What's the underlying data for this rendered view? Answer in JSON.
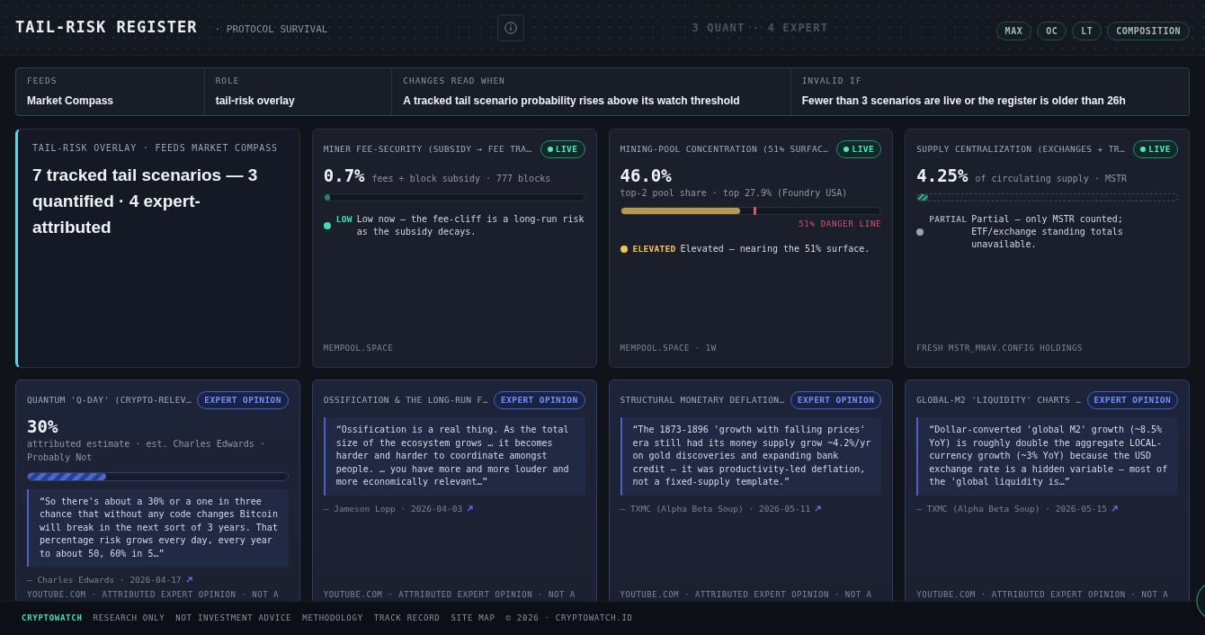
{
  "header": {
    "title": "TAIL-RISK REGISTER",
    "subtitle": "· PROTOCOL SURVIVAL",
    "summary": "3 QUANT · 4 EXPERT",
    "nav": [
      "MAX",
      "OC",
      "LT",
      "COMPOSITION"
    ]
  },
  "info_strip": [
    {
      "label": "FEEDS",
      "value": "Market Compass"
    },
    {
      "label": "ROLE",
      "value": "tail-risk overlay"
    },
    {
      "label": "CHANGES READ WHEN",
      "value": "A tracked tail scenario probability rises above its watch threshold"
    },
    {
      "label": "INVALID IF",
      "value": "Fewer than 3 scenarios are live or the register is older than 26h"
    }
  ],
  "overview": {
    "eyebrow": "TAIL-RISK OVERLAY · FEEDS MARKET COMPASS",
    "headline": "7 tracked tail scenarios — 3 quantified · 4 expert-attributed"
  },
  "scenarios": [
    {
      "kind": "quant",
      "title": "MINER FEE-SECURITY (SUBSIDY → FEE TRA…",
      "badge": {
        "kind": "live",
        "label": "LIVE"
      },
      "value": "0.7%",
      "caption": "fees ÷ block subsidy · 777 blocks",
      "meter": {
        "kind": "solid",
        "level": 0.02
      },
      "status": {
        "label": "LOW",
        "color": "#3ee0b0",
        "text": "Low now — the fee-cliff is a long-run risk as the subsidy decays."
      },
      "source": "MEMPOOL.SPACE"
    },
    {
      "kind": "quant",
      "title": "MINING-POOL CONCENTRATION (51% SURFAC…",
      "badge": {
        "kind": "live",
        "label": "LIVE"
      },
      "value": "46.0%",
      "caption": "top-2 pool share · top 27.9% (Foundry USA)",
      "meter": {
        "kind": "threshold",
        "level": 0.46,
        "threshold": {
          "level": 0.51,
          "label": "51% DANGER LINE"
        }
      },
      "status": {
        "label": "ELEVATED",
        "color": "#f5c451",
        "text": "Elevated — nearing the 51% surface."
      },
      "source": "MEMPOOL.SPACE · 1W"
    },
    {
      "kind": "quant",
      "title": "SUPPLY CENTRALIZATION (EXCHANGES + TR…",
      "badge": {
        "kind": "live",
        "label": "LIVE"
      },
      "value": "4.25%",
      "caption": "of circulating supply · MSTR",
      "meter": {
        "kind": "partial",
        "level": 0.04
      },
      "status": {
        "label": "PARTIAL",
        "color": "#9aa1b2",
        "text": "Partial — only MSTR counted; ETF/exchange standing totals unavailable."
      },
      "source": "FRESH MSTR_MNAV.CONFIG HOLDINGS"
    },
    {
      "kind": "expert",
      "title": "QUANTUM 'Q-DAY' (CRYPTO-RELEV…",
      "badge": {
        "kind": "expert",
        "label": "EXPERT OPINION"
      },
      "value": "30%",
      "caption": "attributed estimate · est. Charles Edwards · Probably Not",
      "meter": {
        "kind": "striped",
        "level": 0.3
      },
      "quote": "“So there's about a 30% or a one in three chance that without any code changes Bitcoin will break in the next sort of 3 years. That percentage risk grows every day, every year to about 50, 60% in 5…”",
      "attribution": "— Charles Edwards · 2026-04-17",
      "source": "YOUTUBE.COM · ATTRIBUTED EXPERT OPINION · NOT A"
    },
    {
      "kind": "expert",
      "title": "OSSIFICATION & THE LONG-RUN F…",
      "badge": {
        "kind": "expert",
        "label": "EXPERT OPINION"
      },
      "quote": "“Ossification is a real thing. As the total size of the ecosystem grows … it becomes harder and harder to coordinate amongst people. … you have more and more louder and more economically relevant…”",
      "attribution": "— Jameson Lopp · 2026-04-03",
      "source": "YOUTUBE.COM · ATTRIBUTED EXPERT OPINION · NOT A"
    },
    {
      "kind": "expert",
      "title": "STRUCTURAL MONETARY DEFLATION…",
      "badge": {
        "kind": "expert",
        "label": "EXPERT OPINION"
      },
      "quote": "“The 1873-1896 'growth with falling prices' era still had its money supply grow ~4.2%/yr on gold discoveries and expanding bank credit — it was productivity-led deflation, not a fixed-supply template.”",
      "attribution": "— TXMC (Alpha Beta Soup) · 2026-05-11",
      "source": "YOUTUBE.COM · ATTRIBUTED EXPERT OPINION · NOT A"
    },
    {
      "kind": "expert",
      "title": "GLOBAL-M2 'LIQUIDITY' CHARTS …",
      "badge": {
        "kind": "expert",
        "label": "EXPERT OPINION"
      },
      "quote": "“Dollar-converted 'global M2' growth (~8.5% YoY) is roughly double the aggregate LOCAL-currency growth (~3% YoY) because the USD exchange rate is a hidden variable — most of the 'global liquidity is…”",
      "attribution": "— TXMC (Alpha Beta Soup) · 2026-05-15",
      "source": "YOUTUBE.COM · ATTRIBUTED EXPERT OPINION · NOT A"
    }
  ],
  "footer": {
    "brand": "CRYPTOWATCH",
    "notes": [
      "RESEARCH ONLY",
      "NOT INVESTMENT ADVICE"
    ],
    "links": [
      "METHODOLOGY",
      "TRACK RECORD",
      "SITE MAP"
    ],
    "copyright": "© 2026 · CRYPTOWATCH.ID"
  }
}
